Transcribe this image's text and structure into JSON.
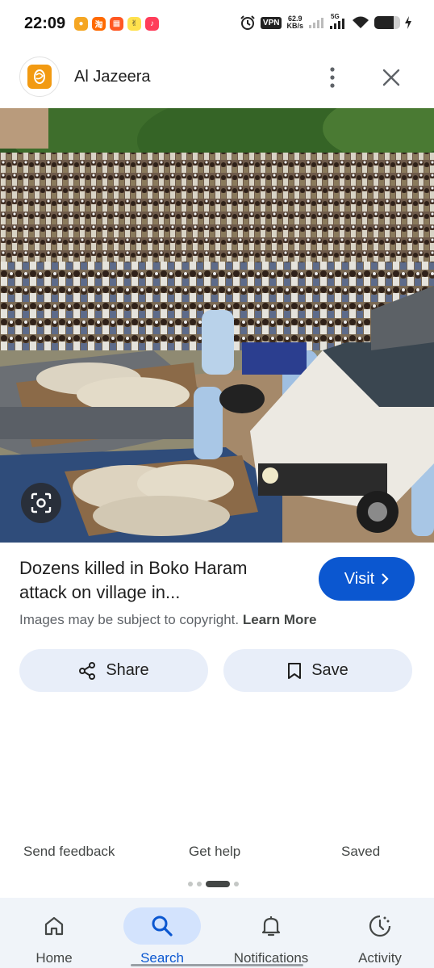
{
  "status_bar": {
    "time": "22:09",
    "vpn_label": "VPN",
    "speed_value": "62.9",
    "speed_unit": "KB/s",
    "network_label": "5G",
    "battery_level": 0.75
  },
  "header": {
    "site_name": "Al Jazeera",
    "logo_color": "#f29a12"
  },
  "result": {
    "title": "Dozens killed in Boko Haram attack on village in...",
    "visit_label": "Visit",
    "copyright_text": "Images may be subject to copyright.",
    "learn_more_label": "Learn More"
  },
  "actions": {
    "share_label": "Share",
    "save_label": "Save"
  },
  "footer": {
    "send_feedback": "Send feedback",
    "get_help": "Get help",
    "saved": "Saved"
  },
  "bottom_nav": {
    "items": [
      {
        "label": "Home",
        "icon": "home-icon"
      },
      {
        "label": "Search",
        "icon": "search-icon",
        "active": true
      },
      {
        "label": "Notifications",
        "icon": "bell-icon"
      },
      {
        "label": "Activity",
        "icon": "activity-icon"
      }
    ]
  },
  "colors": {
    "accent": "#0b57d0",
    "button_bg": "#e8eef9",
    "nav_bg": "#f0f4f9",
    "nav_active_pill": "#d3e3fd"
  }
}
